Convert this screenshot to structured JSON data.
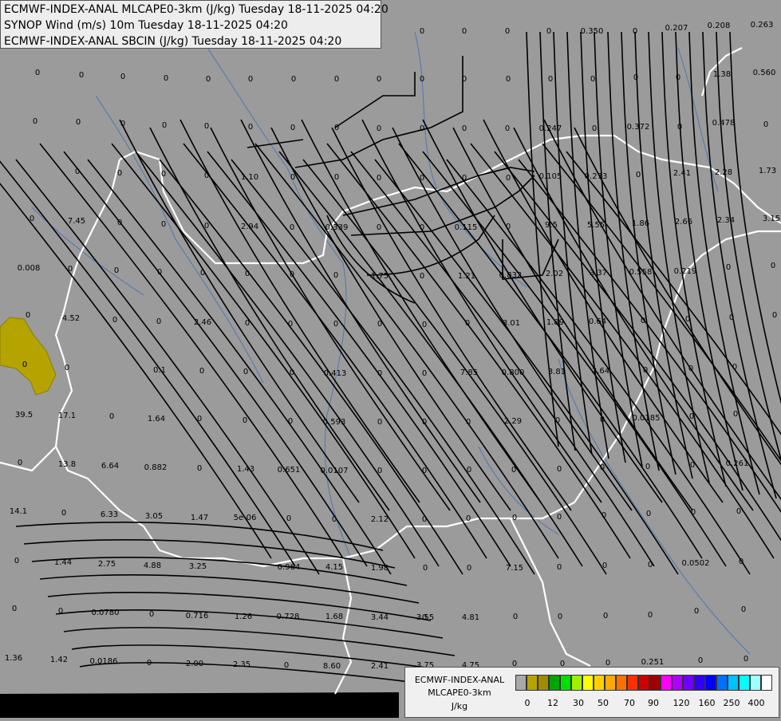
{
  "header": {
    "line1": "ECMWF-INDEX-ANAL MLCAPE0-3km (J/kg) Tuesday 18-11-2025 04:20",
    "line2": "SYNOP Wind (m/s) 10m Tuesday 18-11-2025 04:20",
    "line3": "ECMWF-INDEX-ANAL SBCIN (J/kg) Tuesday 18-11-2025 04:20"
  },
  "legend": {
    "title1": "ECMWF-INDEX-ANAL",
    "title2": "MLCAPE0-3km",
    "unit": "J/kg",
    "colors": [
      "#a9a9a9",
      "#b5a400",
      "#a08a00",
      "#00a400",
      "#00e000",
      "#a0f000",
      "#ffff00",
      "#ffd000",
      "#ffaa00",
      "#ff7000",
      "#ff3000",
      "#d00000",
      "#a00000",
      "#ff00ff",
      "#b000ff",
      "#7000ff",
      "#3000ff",
      "#0000ff",
      "#0070ff",
      "#00c0ff",
      "#00ffff",
      "#a0ffff",
      "#ffffff"
    ],
    "tick_labels": [
      "0",
      "12",
      "30",
      "50",
      "70",
      "90",
      "120",
      "160",
      "250",
      "400"
    ]
  },
  "map_values": [
    [
      "0",
      "x2"
    ],
    [
      "0.350",
      "x1"
    ],
    [
      "0",
      "x3"
    ],
    [
      "0.207",
      "x4"
    ],
    [
      "0.208",
      "x5"
    ],
    [
      "0.263",
      "x6"
    ],
    [
      "0",
      "x7"
    ],
    [
      "0",
      "x8"
    ],
    [
      "1.38",
      "x9"
    ],
    [
      "0.560",
      "x10"
    ],
    [
      "0.247",
      "x11"
    ],
    [
      "0.372",
      "x12"
    ],
    [
      "0.478",
      "x13"
    ],
    [
      "0.105",
      "x14"
    ],
    [
      "0.273",
      "x15"
    ],
    [
      "2.41",
      "x16"
    ],
    [
      "2.28",
      "x17"
    ],
    [
      "1.73",
      "x18"
    ],
    [
      "1.10",
      "x19"
    ],
    [
      "7.45",
      "x20"
    ],
    [
      "2.94",
      "x21"
    ],
    [
      "0.339",
      "x22"
    ],
    [
      "0.115",
      "x23"
    ],
    [
      "9.5",
      "x24"
    ],
    [
      "5.55",
      "x25"
    ],
    [
      "1.86",
      "x26"
    ],
    [
      "2.66",
      "x27"
    ],
    [
      "2.34",
      "x28"
    ],
    [
      "3.15",
      "x29"
    ],
    [
      "0.008",
      "x30"
    ],
    [
      "1.75",
      "x31"
    ],
    [
      "1.21",
      "x32"
    ],
    [
      "0.832",
      "x33"
    ],
    [
      "2.02",
      "x34"
    ],
    [
      "3.37",
      "x35"
    ],
    [
      "0.558",
      "x36"
    ],
    [
      "0.219",
      "x37"
    ],
    [
      "4.52",
      "x38"
    ],
    [
      "2.46",
      "x39"
    ],
    [
      "3.01",
      "x40"
    ],
    [
      "1.89",
      "x41"
    ],
    [
      "0.64",
      "x42"
    ],
    [
      "0.1",
      "x43"
    ],
    [
      "0.413",
      "x44"
    ],
    [
      "7.85",
      "x45"
    ],
    [
      "0.800",
      "x46"
    ],
    [
      "3.81",
      "x47"
    ],
    [
      "2.64",
      "x48"
    ],
    [
      "39.5",
      "x49"
    ],
    [
      "17.1",
      "x50"
    ],
    [
      "1.64",
      "x51"
    ],
    [
      "0.593",
      "x52"
    ],
    [
      "2.29",
      "x53"
    ],
    [
      "0.0185",
      "x54"
    ],
    [
      "13.8",
      "x55"
    ],
    [
      "6.64",
      "x56"
    ],
    [
      "0.882",
      "x57"
    ],
    [
      "1.43",
      "x58"
    ],
    [
      "0.651",
      "x59"
    ],
    [
      "0.0107",
      "x60"
    ],
    [
      "0.261",
      "x61"
    ],
    [
      "14.1",
      "x62"
    ],
    [
      "6.33",
      "x63"
    ],
    [
      "3.05",
      "x64"
    ],
    [
      "1.47",
      "x65"
    ],
    [
      "5e-06",
      "x66"
    ],
    [
      "2.12",
      "x67"
    ],
    [
      "1.44",
      "x68"
    ],
    [
      "2.75",
      "x69"
    ],
    [
      "4.88",
      "x70"
    ],
    [
      "3.25",
      "x71"
    ],
    [
      "0.964",
      "x72"
    ],
    [
      "4.15",
      "x73"
    ],
    [
      "1.98",
      "x74"
    ],
    [
      "7.15",
      "x75"
    ],
    [
      "0.0502",
      "x76"
    ],
    [
      "0.0780",
      "x77"
    ],
    [
      "0.716",
      "x78"
    ],
    [
      "1.26",
      "x79"
    ],
    [
      "0.728",
      "x80"
    ],
    [
      "1.68",
      "x81"
    ],
    [
      "3.44",
      "x82"
    ],
    [
      "3.55",
      "x83"
    ],
    [
      "4.81",
      "x84"
    ],
    [
      "1.36",
      "x85"
    ],
    [
      "1.42",
      "x86"
    ],
    [
      "0.0186",
      "x87"
    ],
    [
      "2.00",
      "x88"
    ],
    [
      "2.35",
      "x89"
    ],
    [
      "8.60",
      "x90"
    ],
    [
      "2.41",
      "x91"
    ],
    [
      "3.75",
      "x92"
    ],
    [
      "4.75",
      "x93"
    ],
    [
      "0.251",
      "x94"
    ]
  ]
}
